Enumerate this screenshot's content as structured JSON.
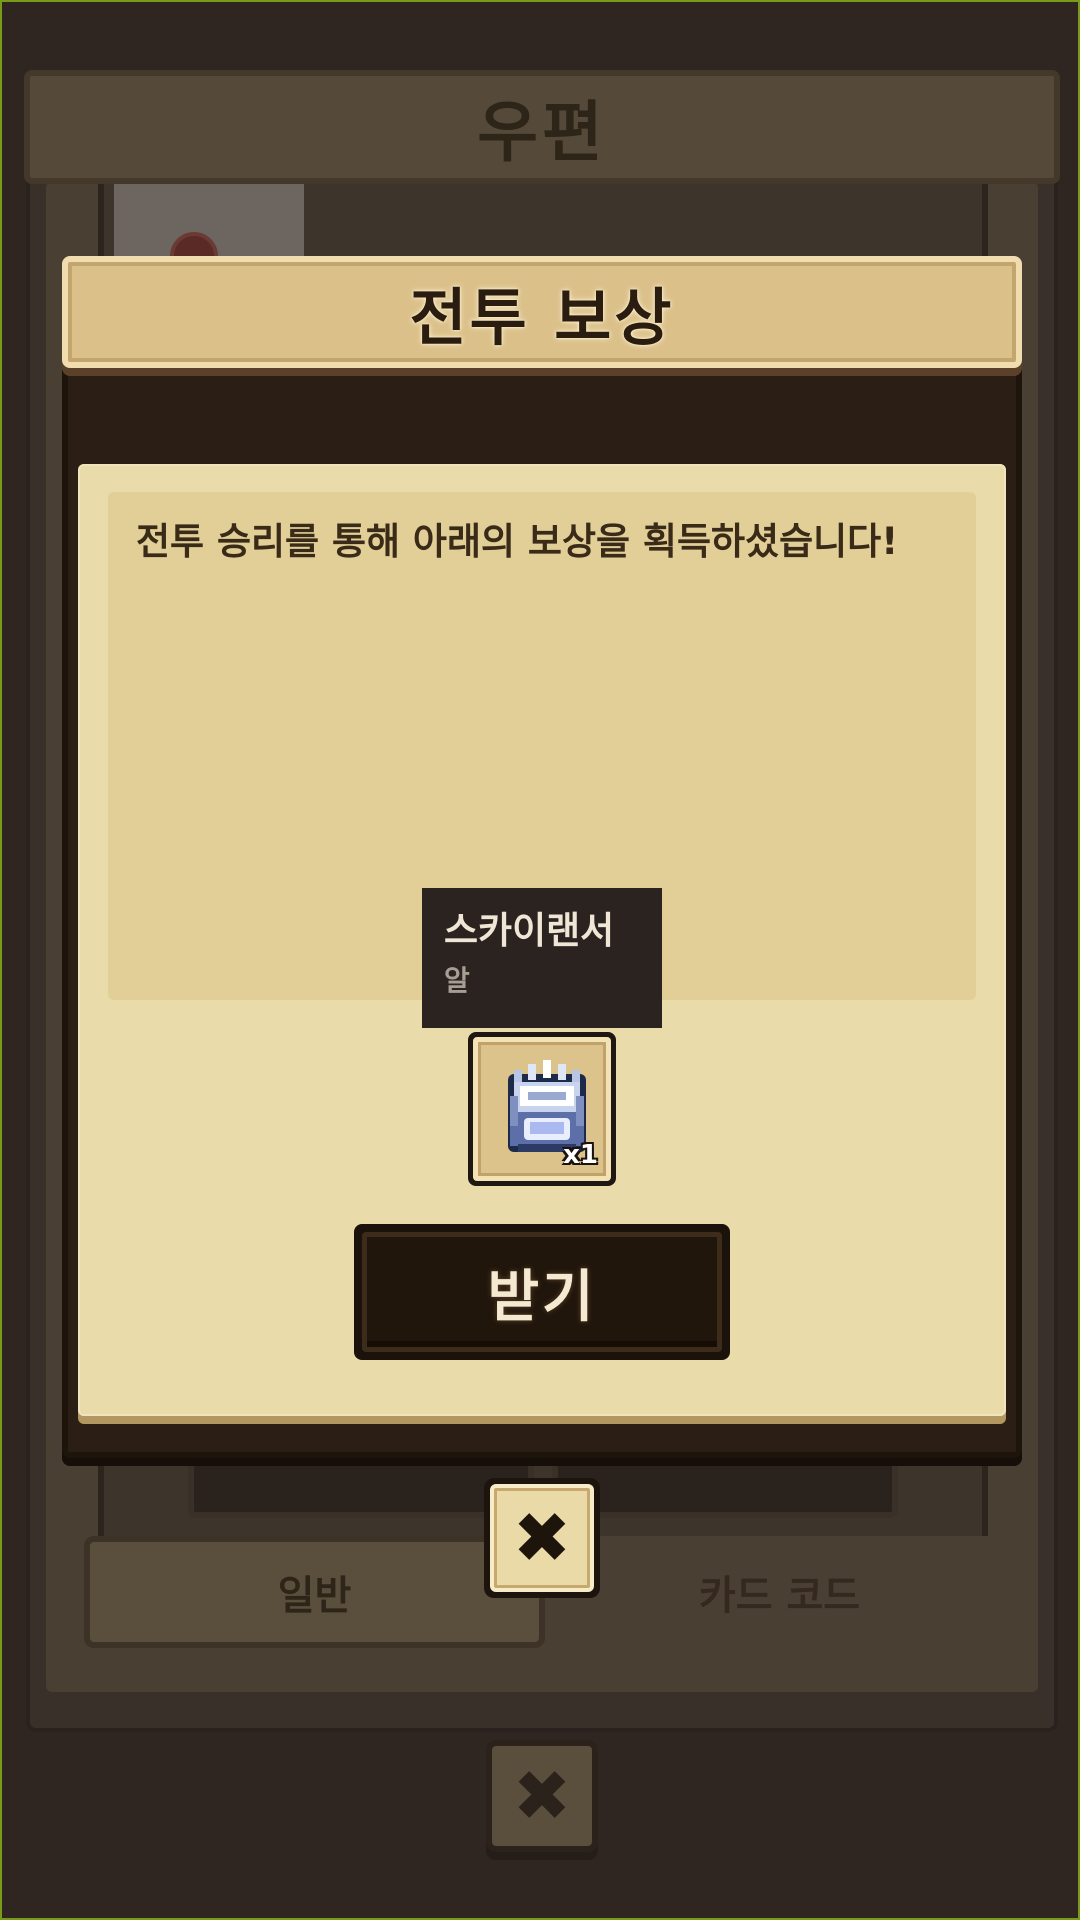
{
  "background": {
    "window_title": "우편",
    "tabs": [
      {
        "label": "일반",
        "active": true
      },
      {
        "label": "카드 코드",
        "active": false
      }
    ],
    "close_icon": "close-icon"
  },
  "dialog": {
    "title": "전투 보상",
    "message": "전투 승리를 통해 아래의 보상을 획득하셨습니다!",
    "reward": {
      "name": "스카이랜서",
      "type": "알",
      "count": "x1",
      "icon": "egg-icon"
    },
    "receive_label": "받기",
    "close_icon": "close-icon"
  },
  "colors": {
    "page_bg": "#2f2622",
    "paper": "#e9dcaa",
    "header": "#dbc08a",
    "button_dark": "#21160c"
  }
}
